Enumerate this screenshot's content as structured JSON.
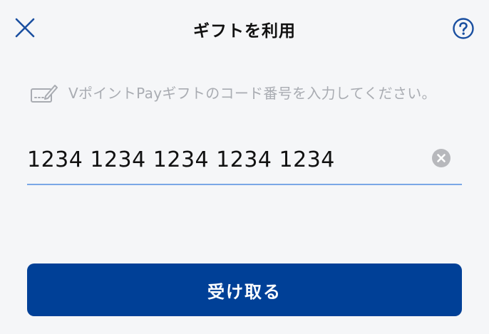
{
  "header": {
    "title": "ギフトを利用",
    "close_icon": "close-icon",
    "help_icon": "help-circle-icon"
  },
  "hint": {
    "icon": "pencil-card-icon",
    "text": "VポイントPayギフトのコード番号を入力してください。"
  },
  "code_input": {
    "value": "1234 1234 1234 1234 1234",
    "clear_icon": "clear-circle-icon"
  },
  "submit": {
    "label": "受け取る"
  },
  "colors": {
    "background": "#f5f6f8",
    "accent": "#004097",
    "icon_blue": "#1a4fa0",
    "input_underline": "#7aa7e6",
    "hint_text": "#a9acb2"
  }
}
